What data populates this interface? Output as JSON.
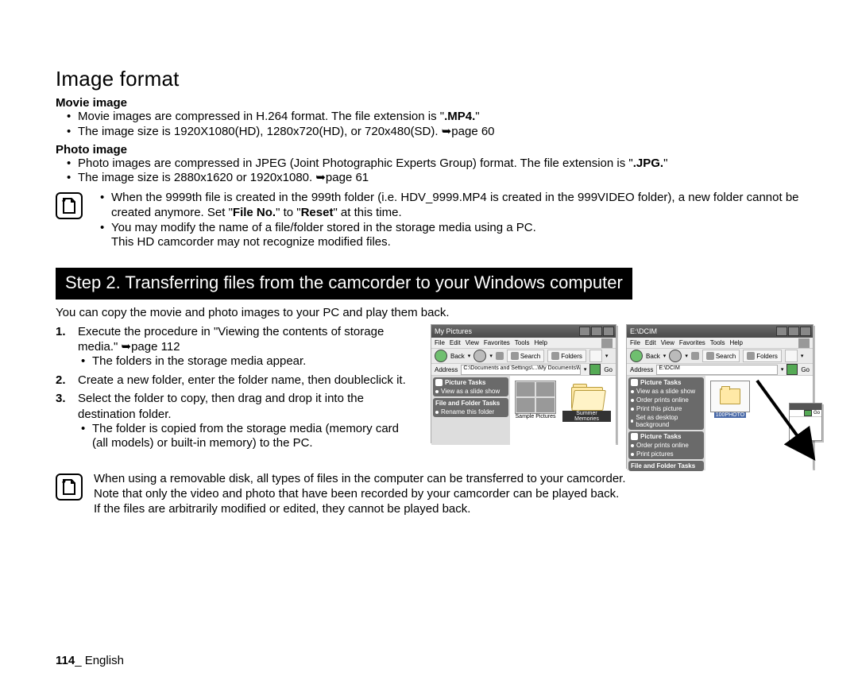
{
  "heading": "Image format",
  "movie": {
    "title": "Movie image",
    "b1_a": "Movie images are compressed in H.264 format. The file extension is \"",
    "b1_b": ".MP4.",
    "b1_c": "\"",
    "b2": "The image size is 1920X1080(HD), 1280x720(HD), or 720x480(SD). ➥page 60"
  },
  "photo": {
    "title": "Photo image",
    "b1_a": "Photo images are compressed in JPEG (Joint Photographic Experts Group) format. The file extension is \"",
    "b1_b": ".JPG.",
    "b1_c": "\"",
    "b2": "The image size is 2880x1620 or 1920x1080. ➥page 61"
  },
  "note1": {
    "l1a": "When the 9999th file is created in the 999th folder (i.e. HDV_9999.MP4 is created in the 999VIDEO folder), a new folder cannot be created anymore. Set \"",
    "l1b": "File No.",
    "l1c": "\" to \"",
    "l1d": "Reset",
    "l1e": "\" at this time.",
    "l2a": "You may modify the name of a file/folder stored in the storage media using a PC.",
    "l2b": "This HD camcorder may not recognize modified files."
  },
  "step_banner": "Step 2. Transferring files from the camcorder to your Windows computer",
  "intro": "You can copy the movie and photo images to your PC and play them back.",
  "steps": {
    "s1": "Execute the procedure in \"Viewing the contents of storage media.\" ➥page 112",
    "s1b": "The folders in the storage media appear.",
    "s2": "Create a new folder, enter the folder name, then doubleclick it.",
    "s3": "Select the folder to copy, then drag and drop it into the destination folder.",
    "s3b": "The folder is copied from the storage media (memory card (all models) or built-in memory) to the PC."
  },
  "note2": {
    "l1": "When using a removable disk, all types of files in the computer can be transferred to your camcorder.",
    "l2": "Note that only the video and photo that have been recorded by your camcorder can be played back.",
    "l3": "If the files are arbitrarily modified or edited, they cannot be played back."
  },
  "footer": {
    "page": "114",
    "lang": "_ English"
  },
  "win_a": {
    "title": "My Pictures",
    "menu": [
      "File",
      "Edit",
      "View",
      "Favorites",
      "Tools",
      "Help"
    ],
    "bar": {
      "back": "Back",
      "search": "Search",
      "folders": "Folders"
    },
    "addr_label": "Address",
    "addr": "C:\\Documents and Settings\\...\\My Documents\\My Pictures",
    "go": "Go",
    "panel1": "Picture Tasks",
    "p1_items": [
      "View as a slide show"
    ],
    "panel2": "File and Folder Tasks",
    "p2_items": [
      "Rename this folder"
    ],
    "thumb_label": "Sample Pictures",
    "new_folder_label": "Summer Memories"
  },
  "win_b": {
    "title": "E:\\DCIM",
    "menu": [
      "File",
      "Edit",
      "View",
      "Favorites",
      "Tools",
      "Help"
    ],
    "bar": {
      "back": "Back",
      "search": "Search",
      "folders": "Folders"
    },
    "addr_label": "Address",
    "addr": "E:\\DCIM",
    "go": "Go",
    "panel1": "Picture Tasks",
    "p1_items": [
      "View as a slide show",
      "Order prints online",
      "Print this picture",
      "Set as desktop background"
    ],
    "panel2": "Picture Tasks",
    "p2_items": [
      "Order prints online",
      "Print pictures"
    ],
    "panel3": "File and Folder Tasks",
    "folder_label": "100PHOTO",
    "mini_go": "Go"
  }
}
